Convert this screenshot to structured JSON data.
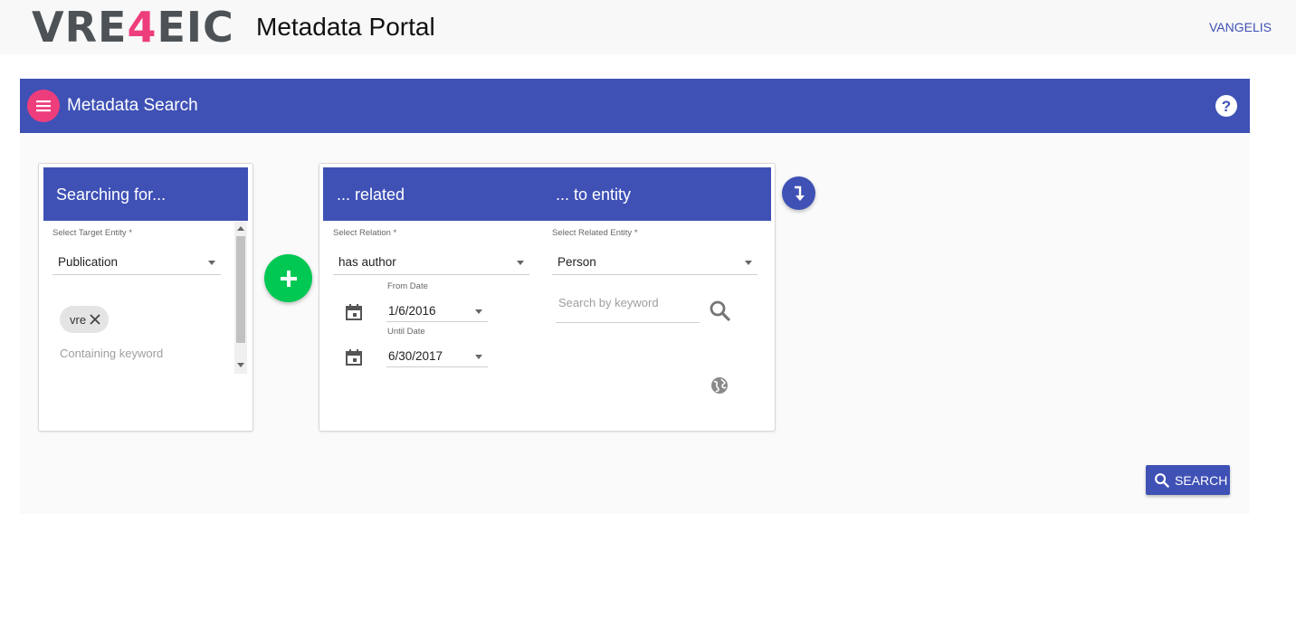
{
  "header": {
    "logo_prefix": "VRE",
    "logo_accent": "4",
    "logo_suffix": "EIC",
    "portal_title": "Metadata Portal",
    "user": "VANGELIS"
  },
  "toolbar": {
    "title": "Metadata Search",
    "help_label": "?"
  },
  "target_card": {
    "heading": "Searching for...",
    "entity_label": "Select Target Entity *",
    "entity_value": "Publication",
    "chips": [
      {
        "label": "vre"
      }
    ],
    "keyword_placeholder": "Containing keyword"
  },
  "relation_card": {
    "heading_left": "... related",
    "heading_right": "... to entity",
    "relation_label": "Select Relation *",
    "relation_value": "has author",
    "from_label": "From Date",
    "from_value": "1/6/2016",
    "until_label": "Until Date",
    "until_value": "6/30/2017",
    "related_entity_label": "Select Related Entity *",
    "related_entity_value": "Person",
    "keyword_placeholder": "Search by keyword"
  },
  "actions": {
    "search_label": "SEARCH"
  },
  "colors": {
    "primary": "#3f51b5",
    "accent": "#ee3d7c",
    "add": "#00c853"
  },
  "icons": [
    "menu-icon",
    "help-icon",
    "plus-icon",
    "calendar-icon",
    "search-icon",
    "globe-icon",
    "close-icon",
    "swap-icon"
  ]
}
